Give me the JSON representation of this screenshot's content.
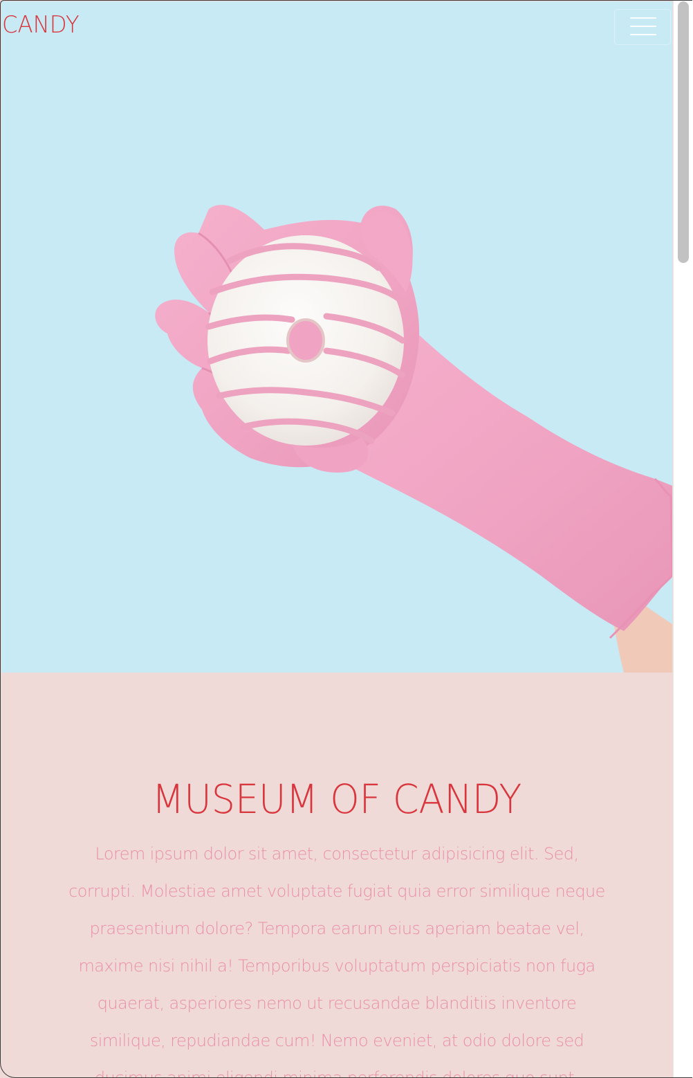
{
  "navbar": {
    "brand": "CANDY",
    "menu_icon": "hamburger-menu-icon"
  },
  "hero": {
    "image_description_icon": "donut-in-pink-glove-image",
    "colors": {
      "sky": "#c8eaf5",
      "glove": "#f2a5c4",
      "icing": "#f7f3ef",
      "stripe": "#eca2c0"
    }
  },
  "about": {
    "title": "MUSEUM OF CANDY",
    "text": "Lorem ipsum dolor sit amet, consectetur adipisicing elit. Sed, corrupti. Molestiae amet voluptate fugiat quia error similique neque praesentium dolore? Tempora earum eius aperiam beatae vel, maxime nisi nihil a! Temporibus voluptatum perspiciatis non fuga quaerat, asperiores nemo ut recusandae blanditiis inventore similique, repudiandae cum! Nemo eveniet, at odio dolore sed ducimus animi eligendi minima perferendis dolores quo sunt."
  },
  "theme": {
    "accent": "#d8353c",
    "body_text": "#ea8fa7",
    "section_bg": "#f0dad8"
  }
}
